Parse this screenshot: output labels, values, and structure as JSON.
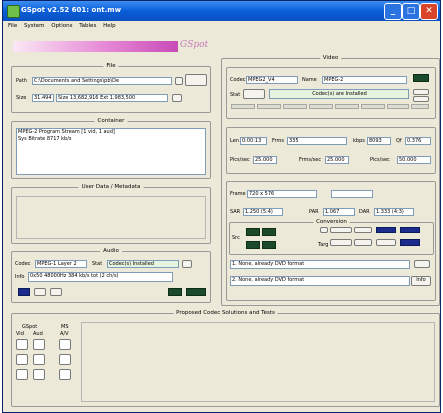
{
  "title": "GSpot v2.52 601: ont.mw",
  "window_buttons": {
    "minimize": "_",
    "maximize": "□",
    "close": "✕"
  },
  "menu": [
    "File",
    "System",
    "Options",
    "Tables",
    "Help"
  ],
  "logo_text": "GSpot",
  "file": {
    "legend": "File",
    "path_label": "Path",
    "path_value": "C:\\Documents and Settings\\pb\\De",
    "size_label": "Size",
    "size_value": "31.494",
    "size_rest": "Size 13,682,916  Ext 1,983,500"
  },
  "container": {
    "legend": "Container",
    "line1": "MPEG-2 Program Stream [1 vid, 1 aud]",
    "line2": "Sys Bitrate 8717 kb/s"
  },
  "user_data": {
    "legend": "User Data / Metadata"
  },
  "audio": {
    "legend": "Audio",
    "codec_label": "Codec",
    "codec_value": "MPEG-1 Layer 2",
    "stat_label": "Stat",
    "stat_value": "Codec(s) Installed",
    "info_label": "Info",
    "info_value": "0x50 48000Hz 384 kb/s tot (2 ch/s)"
  },
  "video": {
    "legend": "Video",
    "codec_label": "Codec",
    "codec_value": "MPEG2_V4",
    "name_label": "Name",
    "name_value": "MPEG-2",
    "stat_label": "Stat",
    "stat_value": "Codec(s) are Installed",
    "len_label": "Len",
    "len_value": "0:00:13",
    "frms_label": "Frms",
    "frms_value": "335",
    "kbps_label": "kbps",
    "kbps_value": "8093",
    "qf_label": "Qf",
    "qf_value": "0.376",
    "pics_label": "Pics/sec",
    "pics_value": "25.000",
    "frms_sec_label": "Frms/sec",
    "frms_sec_value": "25.000",
    "pics_sec2_label": "Pics/sec",
    "pics_sec2_value": "50.000",
    "frame_label": "Frame",
    "frame_value": "720 x 576",
    "sar_label": "SAR",
    "sar_value": "1.250 (5:4)",
    "par_label": "PAR",
    "par_value": "1.067",
    "dar_label": "DAR",
    "dar_value": "1.333 (4:3)",
    "conversion_legend": "Conversion",
    "src_label": "Src",
    "targ_label": "Targ",
    "rec1": "1. None, already DVD format",
    "rec2": "2. None, already DVD format",
    "info_btn": "Info"
  },
  "proposed": {
    "legend": "Proposed Codec Solutions and Tests",
    "gspot_label": "GSpot",
    "ms_label": "MS",
    "vid": "Vid",
    "aud": "Aud",
    "av": "A/V"
  }
}
